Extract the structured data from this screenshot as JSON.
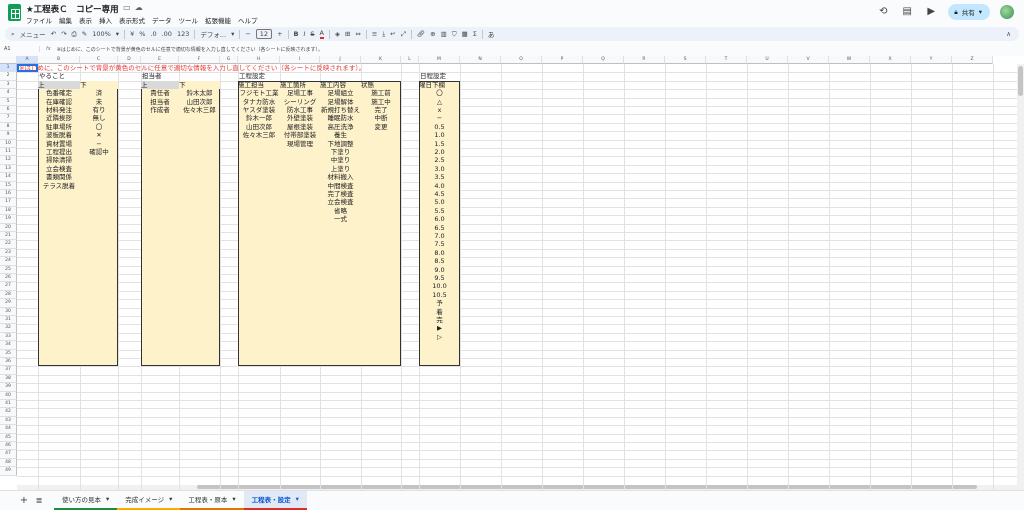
{
  "app": {
    "title": "★工程表Ｃ　コピー専用",
    "menu": [
      "ファイル",
      "編集",
      "表示",
      "挿入",
      "表示形式",
      "データ",
      "ツール",
      "拡張機能",
      "ヘルプ"
    ],
    "share_label": "共有"
  },
  "toolbar": {
    "menu_search": "メニュー",
    "zoom": "100%",
    "currency": "¥",
    "percent": "%",
    "decimals_less": ".0",
    "decimals_more": ".00",
    "number_format": "123",
    "font": "デフォ...",
    "font_size": "12"
  },
  "formula_bar": {
    "cell_ref": "A1",
    "content": "※はじめに、このシートで背景が黄色のセルに任意で適切な情報を入力し直してください（各シートに反映されます）。"
  },
  "columns": [
    "A",
    "B",
    "C",
    "D",
    "E",
    "F",
    "G",
    "H",
    "I",
    "J",
    "K",
    "L",
    "M",
    "N",
    "O",
    "P",
    "Q",
    "R",
    "S",
    "T",
    "U",
    "V",
    "W",
    "X",
    "Y",
    "Z"
  ],
  "notice": "※はじめに、このシートで背景が黄色のセルに任意で適切な情報を入力し直してください（各シートに反映されます）。",
  "sections": {
    "todo": {
      "title": "やること",
      "headers": [
        "上",
        "下"
      ],
      "col1": [
        "色番確定",
        "在庫確認",
        "材料発注",
        "近隣挨拶",
        "駐車場所",
        "波板脱着",
        "資材置場",
        "工程提出",
        "掃除清掃",
        "立会検査",
        "書類関係",
        "テラス脱着"
      ],
      "col2": [
        "済",
        "未",
        "有り",
        "無し",
        "〇",
        "✕",
        "−",
        "確認中"
      ]
    },
    "staff": {
      "title": "担当者",
      "headers": [
        "上",
        "下"
      ],
      "col1": [
        "責任者",
        "担当者",
        "作成者"
      ],
      "col2": [
        "鈴木太郎",
        "山田次郎",
        "佐々木三郎"
      ]
    },
    "process": {
      "title": "工程設定",
      "headers": [
        "施工担当",
        "施工箇所",
        "施工内容",
        "状態"
      ],
      "col1": [
        "フジモト工業",
        "タナカ防水",
        "ヤスダ塗装",
        "鈴木一郎",
        "山田次郎",
        "佐々木三郎"
      ],
      "col2": [
        "足場工事",
        "シーリング",
        "防水工事",
        "外壁塗装",
        "屋根塗装",
        "付帯部塗装",
        "現場管理"
      ],
      "col3": [
        "足場組立",
        "足場解体",
        "新規打ち替え",
        "睡眠防水",
        "高圧洗浄",
        "養生",
        "下地調整",
        "下塗り",
        "中塗り",
        "上塗り",
        "材料搬入",
        "中間検査",
        "完了検査",
        "立会検査",
        "省略",
        "一式"
      ],
      "col4": [
        "施工前",
        "施工中",
        "完了",
        "中断",
        "変更"
      ]
    },
    "days": {
      "title": "日程設定",
      "header": "曜日下欄",
      "values": [
        "〇",
        "△",
        "ｘ",
        "−",
        "0.5",
        "1.0",
        "1.5",
        "2.0",
        "2.5",
        "3.0",
        "3.5",
        "4.0",
        "4.5",
        "5.0",
        "5.5",
        "6.0",
        "6.5",
        "7.0",
        "7.5",
        "8.0",
        "8.5",
        "9.0",
        "9.5",
        "10.0",
        "10.5",
        "予",
        "着",
        "完",
        "▶",
        "▷"
      ]
    }
  },
  "sheet_tabs": [
    {
      "label": "使い方の見本",
      "color": "#1e8e3e",
      "active": false
    },
    {
      "label": "完成イメージ",
      "color": "#f9ab00",
      "active": false
    },
    {
      "label": "工程表・原本",
      "color": "#e37400",
      "active": false
    },
    {
      "label": "工程表・設定",
      "color": "#d93025",
      "active": true
    }
  ]
}
